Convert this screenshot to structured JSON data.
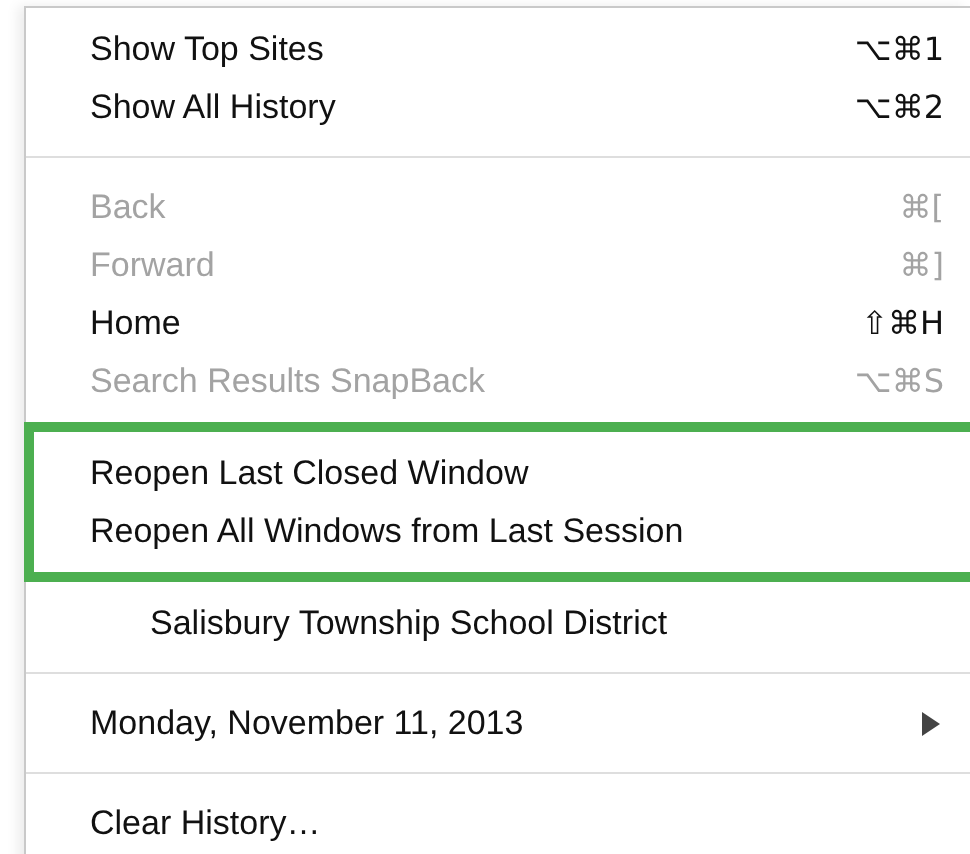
{
  "menu": {
    "sections": [
      {
        "outlined": false,
        "items": [
          {
            "kind": "item",
            "label": "Show Top Sites",
            "shortcut": "⌥⌘1",
            "disabled": false
          },
          {
            "kind": "item",
            "label": "Show All History",
            "shortcut": "⌥⌘2",
            "disabled": false
          }
        ]
      },
      {
        "outlined": false,
        "items": [
          {
            "kind": "item",
            "label": "Back",
            "shortcut": "⌘[",
            "disabled": true
          },
          {
            "kind": "item",
            "label": "Forward",
            "shortcut": "⌘]",
            "disabled": true
          },
          {
            "kind": "item",
            "label": "Home",
            "shortcut": "⇧⌘H",
            "disabled": false
          },
          {
            "kind": "item",
            "label": "Search Results SnapBack",
            "shortcut": "⌥⌘S",
            "disabled": true
          }
        ]
      },
      {
        "outlined": true,
        "items": [
          {
            "kind": "item",
            "label": "Reopen Last Closed Window",
            "disabled": false
          },
          {
            "kind": "item",
            "label": "Reopen All Windows from Last Session",
            "disabled": false
          }
        ]
      },
      {
        "outlined": false,
        "items": [
          {
            "kind": "heading",
            "label": "Salisbury Township School District",
            "disabled": false
          }
        ]
      },
      {
        "outlined": false,
        "items": [
          {
            "kind": "item",
            "label": "Monday, November 11, 2013",
            "submenu": true,
            "disabled": false
          }
        ]
      },
      {
        "outlined": false,
        "items": [
          {
            "kind": "item",
            "label": "Clear History…",
            "disabled": false
          }
        ]
      }
    ]
  }
}
